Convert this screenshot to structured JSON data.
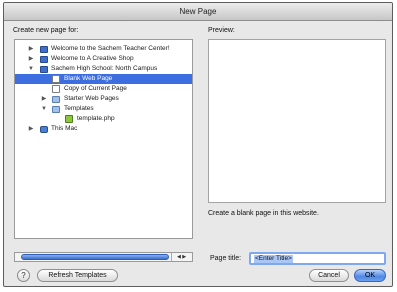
{
  "window": {
    "title": "New Page"
  },
  "left_panel": {
    "heading": "Create new page for:"
  },
  "tree": [
    {
      "label": "Welcome to the Sachem Teacher Center!",
      "icon": "site-globe-icon",
      "expander": "▶",
      "depth": 0,
      "selected": false
    },
    {
      "label": "Welcome to A Creative Shop",
      "icon": "site-globe-icon",
      "expander": "▶",
      "depth": 0,
      "selected": false
    },
    {
      "label": "Sachem High School: North Campus",
      "icon": "site-globe-icon",
      "expander": "▼",
      "depth": 0,
      "selected": false
    },
    {
      "label": "Blank Web Page",
      "icon": "blank-page-icon",
      "expander": "",
      "depth": 1,
      "selected": true
    },
    {
      "label": "Copy of Current Page",
      "icon": "copy-page-icon",
      "expander": "",
      "depth": 1,
      "selected": false
    },
    {
      "label": "Starter Web Pages",
      "icon": "folder-icon",
      "expander": "▶",
      "depth": 1,
      "selected": false
    },
    {
      "label": "Templates",
      "icon": "folder-icon",
      "expander": "▼",
      "depth": 1,
      "selected": false
    },
    {
      "label": "template.php",
      "icon": "php-file-icon",
      "expander": "",
      "depth": 2,
      "selected": false
    },
    {
      "label": "This Mac",
      "icon": "computer-icon",
      "expander": "▶",
      "depth": 0,
      "selected": false
    }
  ],
  "right_panel": {
    "heading": "Preview:",
    "description": "Create a blank page in this website."
  },
  "page_title": {
    "label": "Page title:",
    "value": "<Enter Title>"
  },
  "buttons": {
    "help": "?",
    "refresh": "Refresh Templates",
    "cancel": "Cancel",
    "ok": "OK"
  },
  "colors": {
    "selection": "#3d6ee0",
    "default_button": "#4f88e6"
  }
}
